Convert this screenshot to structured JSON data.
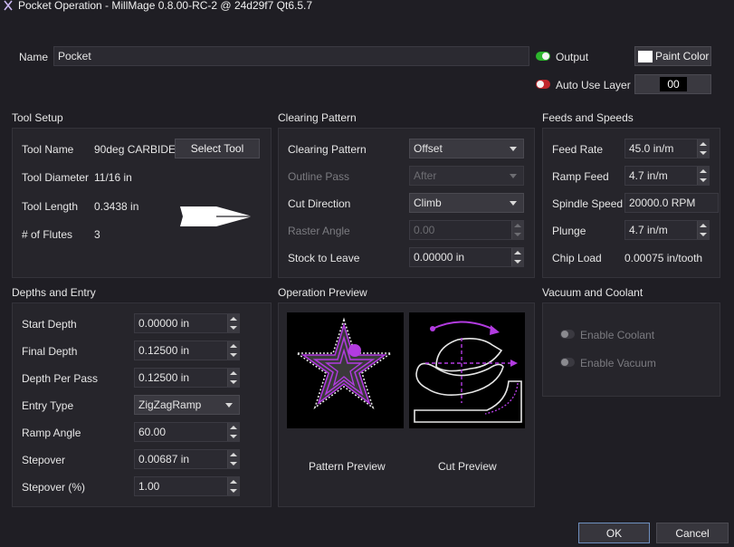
{
  "window": {
    "title": "Pocket Operation - MillMage 0.8.00-RC-2 @ 24d29f7 Qt6.5.7"
  },
  "header": {
    "name_label": "Name",
    "name_value": "Pocket",
    "output_label": "Output",
    "output_enabled": true,
    "auto_use_layer_label": "Auto Use Layer",
    "auto_use_layer_enabled": false,
    "paint_color_label": "Paint Color",
    "layer_value": "00",
    "colors": {
      "output_on": "#2db52d",
      "auto_off": "#c0262c"
    }
  },
  "tool_setup": {
    "title": "Tool Setup",
    "rows": [
      {
        "label": "Tool Name",
        "value": "90deg CARBIDE"
      },
      {
        "label": "Tool Diameter",
        "value": "11/16 in"
      },
      {
        "label": "Tool Length",
        "value": "0.3438 in"
      },
      {
        "label": "# of Flutes",
        "value": "3"
      }
    ],
    "select_tool_label": "Select Tool",
    "tool_icon": "vbit-tool-icon"
  },
  "clearing_pattern": {
    "title": "Clearing Pattern",
    "rows": [
      {
        "label": "Clearing Pattern",
        "value": "Offset",
        "enabled": true
      },
      {
        "label": "Outline Pass",
        "value": "After",
        "enabled": false
      },
      {
        "label": "Cut Direction",
        "value": "Climb",
        "enabled": true
      },
      {
        "label": "Raster Angle",
        "value": "0.00",
        "enabled": false
      },
      {
        "label": "Stock to Leave",
        "value": "0.00000 in",
        "enabled": true
      }
    ]
  },
  "feeds_speeds": {
    "title": "Feeds and Speeds",
    "rows": [
      {
        "label": "Feed Rate",
        "value": "45.0 in/m"
      },
      {
        "label": "Ramp Feed",
        "value": "4.7 in/m"
      },
      {
        "label": "Spindle Speed",
        "value": "20000.0 RPM"
      },
      {
        "label": "Plunge",
        "value": "4.7 in/m"
      }
    ],
    "chip_load_label": "Chip Load",
    "chip_load_value": "0.00075 in/tooth"
  },
  "depths_entry": {
    "title": "Depths and Entry",
    "rows": [
      {
        "label": "Start Depth",
        "value": "0.00000 in"
      },
      {
        "label": "Final Depth",
        "value": "0.12500 in"
      },
      {
        "label": "Depth Per Pass",
        "value": "0.12500 in"
      },
      {
        "label": "Entry Type",
        "value": "ZigZagRamp"
      },
      {
        "label": "Ramp Angle",
        "value": "60.00"
      },
      {
        "label": "Stepover",
        "value": "0.00687 in"
      },
      {
        "label": "Stepover (%)",
        "value": "1.00"
      }
    ]
  },
  "operation_preview": {
    "title": "Operation Preview",
    "pattern_label": "Pattern Preview",
    "cut_label": "Cut Preview",
    "accent": "#b23be0"
  },
  "vacuum_coolant": {
    "title": "Vacuum and Coolant",
    "coolant_label": "Enable Coolant",
    "vacuum_label": "Enable Vacuum"
  },
  "footer": {
    "ok_label": "OK",
    "cancel_label": "Cancel"
  }
}
